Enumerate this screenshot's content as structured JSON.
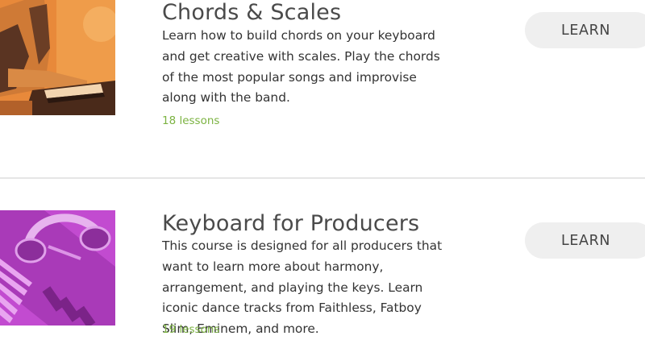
{
  "courses": [
    {
      "title": "Chords & Scales",
      "description": "Learn how to build chords on your keyboard and get creative with scales. Play the chords of the most popular songs and improvise along with the band.",
      "lessons": "18 lessons",
      "button_label": "LEARN",
      "thumb_color": "#e8893a",
      "thumb_icon": "pianist-photo"
    },
    {
      "title": "Keyboard for Producers",
      "description": "This course is designed for all producers that want to learn more about harmony, arrangement, and playing the keys. Learn iconic dance tracks from Faithless, Fatboy Slim, Eminem, and more.",
      "lessons": "19 lessons",
      "button_label": "LEARN",
      "thumb_color": "#c24bd0",
      "thumb_icon": "headphones-keyboard-photo"
    }
  ],
  "colors": {
    "lessons_text": "#7cb342",
    "button_bg": "#efefef",
    "divider": "#e6e6e6"
  }
}
